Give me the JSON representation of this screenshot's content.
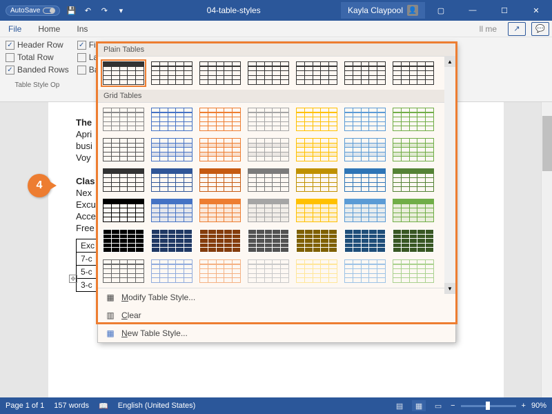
{
  "titlebar": {
    "autosave": "AutoSave",
    "filename": "04-table-styles",
    "user": "Kayla Claypool"
  },
  "tabs": {
    "file": "File",
    "home": "Home",
    "insert": "Ins",
    "tellme": "ll me"
  },
  "style_options": {
    "header_row": "Header Row",
    "total_row": "Total Row",
    "banded_rows": "Banded Rows",
    "first_col": "Fi",
    "last_col": "La",
    "banded_cols": "Ba",
    "group_label": "Table Style Op"
  },
  "gallery": {
    "plain_header": "Plain Tables",
    "grid_header": "Grid Tables",
    "modify": "odify Table Style...",
    "modify_u": "M",
    "clear": "lear",
    "clear_u": "C",
    "new_style": "ew Table Style...",
    "new_style_u": "N"
  },
  "doc": {
    "l1": "The",
    "l2": "Apri",
    "l3": "busi",
    "l4": "Voy",
    "l5": "Clas",
    "l6": "Nex",
    "l7": "Excu",
    "l8": "Acce",
    "l9": "Free",
    "t1": "Exc",
    "t2": "7-c",
    "t3": "5-c",
    "t4": "3-c"
  },
  "status": {
    "page": "Page 1 of 1",
    "words": "157 words",
    "lang": "English (United States)",
    "zoom": "90%"
  },
  "callout": "4",
  "thumb_colors": {
    "plain": [
      "#333",
      "#333",
      "#333",
      "#333",
      "#333",
      "#333",
      "#333"
    ],
    "grid_rows": [
      [
        "#888",
        "#4472c4",
        "#ed7d31",
        "#a5a5a5",
        "#ffc000",
        "#5b9bd5",
        "#70ad47"
      ],
      [
        "#555",
        "#4472c4",
        "#ed7d31",
        "#a5a5a5",
        "#ffc000",
        "#5b9bd5",
        "#70ad47"
      ],
      [
        "#333",
        "#2f5597",
        "#c55a11",
        "#7b7b7b",
        "#bf9000",
        "#2e75b6",
        "#548235"
      ],
      [
        "#000",
        "#4472c4",
        "#ed7d31",
        "#a5a5a5",
        "#ffc000",
        "#5b9bd5",
        "#70ad47"
      ],
      [
        "#000",
        "#1f3864",
        "#843c0c",
        "#525252",
        "#7f6000",
        "#1f4e79",
        "#385723"
      ],
      [
        "#666",
        "#8faadc",
        "#f4b183",
        "#c9c9c9",
        "#ffe699",
        "#9dc3e6",
        "#a9d18e"
      ]
    ]
  }
}
